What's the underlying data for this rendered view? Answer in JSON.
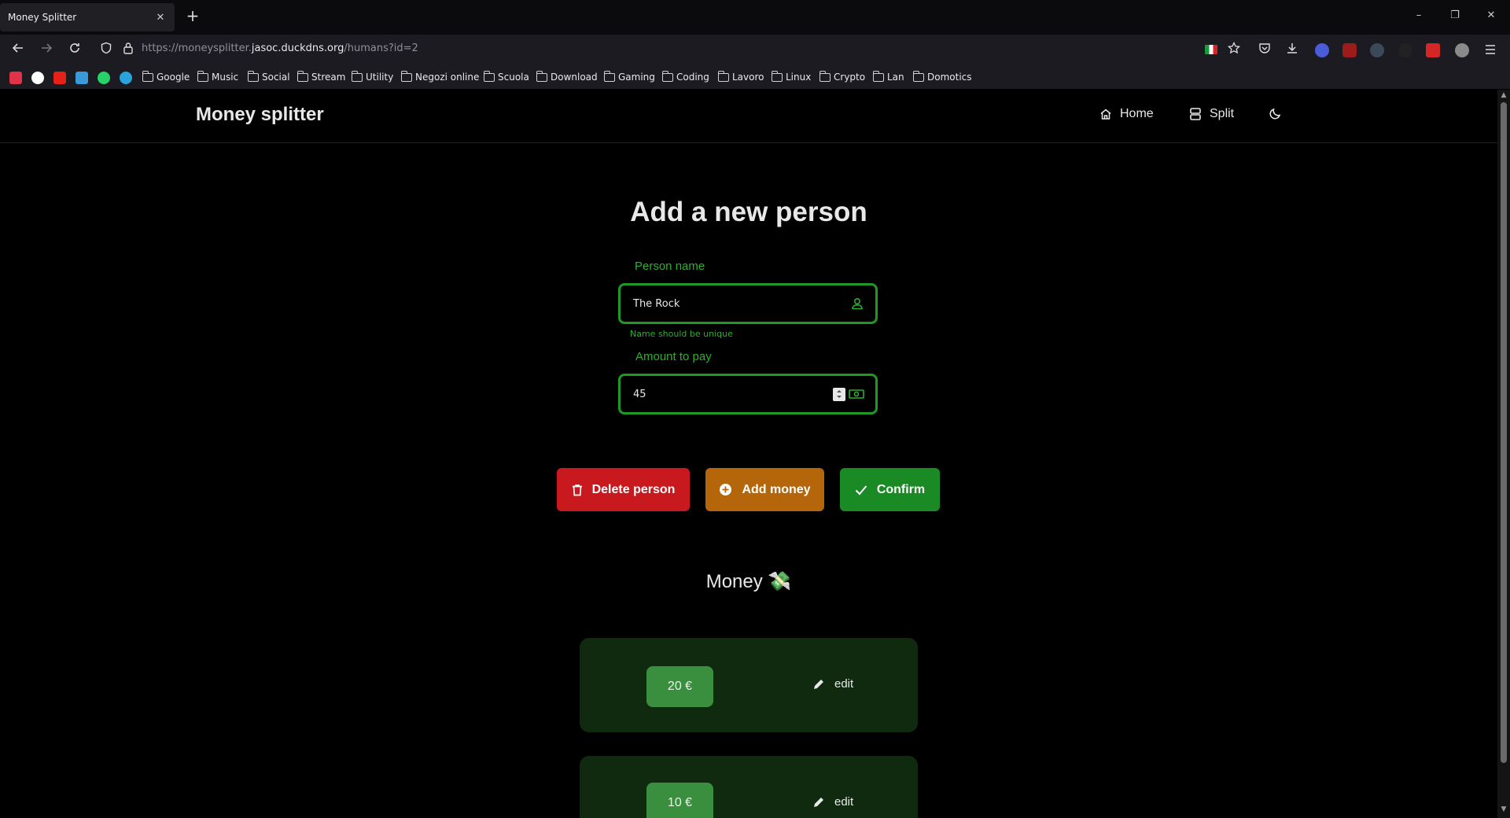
{
  "browser": {
    "tab_title": "Money Splitter",
    "tab_close": "✕",
    "new_tab": "+",
    "url_prefix": "https://moneysplitter.",
    "url_host": "jasoc.duckdns.org",
    "url_path": "/humans?id=2",
    "window_controls": [
      "–",
      "❐",
      "✕"
    ]
  },
  "bookmarks": {
    "folders": [
      "Google",
      "Music",
      "Social",
      "Stream",
      "Utility",
      "Negozi online",
      "Scuola",
      "Download",
      "Gaming",
      "Coding",
      "Lavoro",
      "Linux",
      "Crypto",
      "Lan",
      "Domotics"
    ]
  },
  "app": {
    "brand": "Money splitter",
    "nav": {
      "home": "Home",
      "split": "Split"
    },
    "page_title": "Add a new person",
    "form": {
      "name_label": "Person name",
      "name_value": "The Rock",
      "name_hint": "Name should be unique",
      "amount_label": "Amount to pay",
      "amount_value": "45"
    },
    "buttons": {
      "delete": "Delete person",
      "add_money": "Add money",
      "confirm": "Confirm"
    },
    "money_section_title": "Money 💸",
    "money_items": [
      {
        "amount": "20 €",
        "edit_label": "edit"
      },
      {
        "amount": "10 €",
        "edit_label": "edit"
      }
    ]
  },
  "colors": {
    "accent_green": "#1e9a22",
    "delete_red": "#c8191f",
    "add_orange": "#b5650a",
    "confirm_green": "#1a8a24",
    "card_bg": "#0f2a0f",
    "badge_green": "#3a8f3f"
  }
}
